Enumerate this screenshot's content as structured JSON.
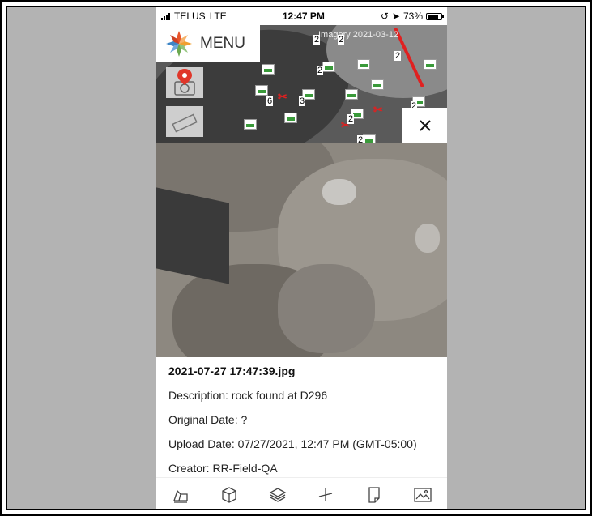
{
  "status_bar": {
    "carrier": "TELUS",
    "network": "LTE",
    "time": "12:47 PM",
    "battery": "73%"
  },
  "map": {
    "imagery_label": "Imagery 2021-03-12",
    "marker_counts": [
      "2",
      "2",
      "2",
      "6",
      "3",
      "2",
      "2",
      "2",
      "2"
    ]
  },
  "menu": {
    "label": "MENU"
  },
  "tools": {
    "camera": "camera-pin-icon",
    "ruler": "ruler-icon"
  },
  "close": {
    "label": "×"
  },
  "photo": {
    "filename": "2021-07-27 17:47:39.jpg",
    "description": "Description: rock found at D296",
    "original_date": "Original Date: ?",
    "upload_date": "Upload Date: 07/27/2021, 12:47 PM (GMT-05:00)",
    "creator": "Creator: RR-Field-QA"
  },
  "tabbar": {
    "items": [
      {
        "icon": "survey-equipment-icon"
      },
      {
        "icon": "3d-cube-icon"
      },
      {
        "icon": "layers-icon"
      },
      {
        "icon": "measure-icon"
      },
      {
        "icon": "document-icon"
      },
      {
        "icon": "image-icon"
      }
    ]
  }
}
